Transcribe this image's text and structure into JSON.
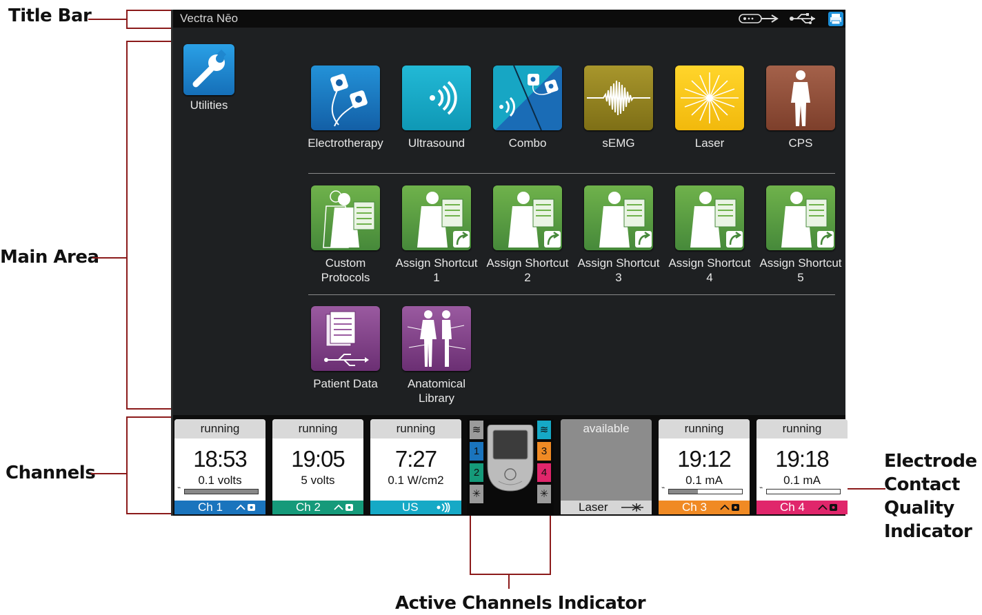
{
  "annotations": {
    "title_bar": "Title Bar",
    "main_area": "Main Area",
    "channels": "Channels",
    "electrode_l1": "Electrode",
    "electrode_l2": "Contact",
    "electrode_l3": "Quality",
    "electrode_l4": "Indicator",
    "active_channels": "Active Channels Indicator"
  },
  "titlebar": {
    "title": "Vectra Nēo",
    "icons": [
      "probe-icon",
      "usb-icon",
      "printer-icon"
    ]
  },
  "main": {
    "utilities": "Utilities",
    "modalities": [
      {
        "label": "Electrotherapy",
        "icon": "electrotherapy-icon",
        "color": "#1a74bd"
      },
      {
        "label": "Ultrasound",
        "icon": "ultrasound-icon",
        "color": "#16a9c6"
      },
      {
        "label": "Combo",
        "icon": "combo-icon",
        "color": "#1a74bd"
      },
      {
        "label": "sEMG",
        "icon": "semg-icon",
        "color": "#9b8a24"
      },
      {
        "label": "Laser",
        "icon": "laser-icon",
        "color": "#f2c313"
      },
      {
        "label": "CPS",
        "icon": "cps-icon",
        "color": "#94513a"
      }
    ],
    "protocols": {
      "custom_line1": "Custom",
      "custom_line2": "Protocols",
      "shortcuts": [
        {
          "line1": "Assign Shortcut",
          "line2": "1"
        },
        {
          "line1": "Assign Shortcut",
          "line2": "2"
        },
        {
          "line1": "Assign Shortcut",
          "line2": "3"
        },
        {
          "line1": "Assign Shortcut",
          "line2": "4"
        },
        {
          "line1": "Assign Shortcut",
          "line2": "5"
        }
      ]
    },
    "data": {
      "patient": "Patient Data",
      "anat_line1": "Anatomical",
      "anat_line2": "Library"
    }
  },
  "channels": [
    {
      "status": "running",
      "time": "18:53",
      "value": "0.1 volts",
      "contact": 1.0,
      "name": "Ch 1",
      "color": "#1a74bd",
      "symbol": "electrode"
    },
    {
      "status": "running",
      "time": "19:05",
      "value": "5 volts",
      "name": "Ch 2",
      "color": "#159a7a",
      "symbol": "electrode"
    },
    {
      "status": "running",
      "time": "7:27",
      "value": "0.1 W/cm2",
      "name": "US",
      "color": "#16a9c6",
      "symbol": "ultrasound"
    },
    {
      "status": "available",
      "name": "Laser",
      "color": "#c8c8c8",
      "symbol": "laser"
    },
    {
      "status": "running",
      "time": "19:12",
      "value": "0.1 mA",
      "contact": 0.4,
      "name": "Ch 3",
      "color": "#f08a24",
      "symbol": "electrode"
    },
    {
      "status": "running",
      "time": "19:18",
      "value": "0.1 mA",
      "contact": 0.0,
      "name": "Ch 4",
      "color": "#e0266b",
      "symbol": "electrode"
    }
  ],
  "active_indicator": {
    "left": [
      "1",
      "2"
    ],
    "right": [
      "3",
      "4"
    ],
    "colors": {
      "1": "#1a74bd",
      "2": "#159a7a",
      "3": "#f08a24",
      "4": "#e0266b"
    }
  }
}
